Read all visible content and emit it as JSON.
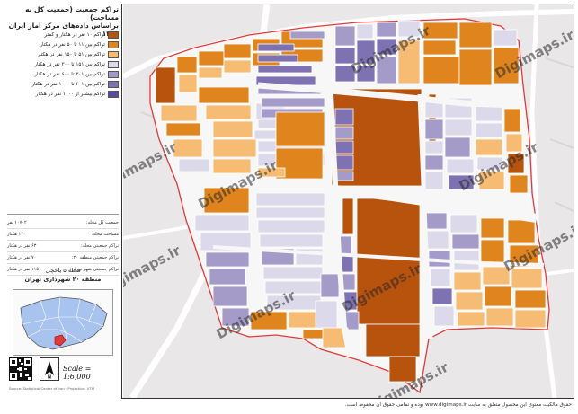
{
  "title": "تراکم جمعیت (جمعیت کل به مساحت)",
  "subtitle": "براساس داده‌های مرکز آمار ایران ۱۳۹۵",
  "legend": [
    {
      "label": "تراکم ۱۰ نفر در هکتار و کمتر",
      "color": "#b8530e"
    },
    {
      "label": "تراکم بین ۱۱ تا ۵۰ نفر در هکتار",
      "color": "#e0851d"
    },
    {
      "label": "تراکم بین ۵۱ تا ۱۵۰ نفر در هکتار",
      "color": "#f6bc73"
    },
    {
      "label": "تراکم بین ۱۵۱ تا ۳۰۰ نفر در هکتار",
      "color": "#dcdaea"
    },
    {
      "label": "تراکم بین ۳۰۱ تا ۶۰۰ نفر در هکتار",
      "color": "#a49bc9"
    },
    {
      "label": "تراکم بین ۶۰۱ تا ۱۰۰۰ نفر در هکتار",
      "color": "#7e72b2"
    },
    {
      "label": "تراکم بیشتر از ۱۰۰۰ نفر در هکتار",
      "color": "#5a4aa0"
    }
  ],
  "stats": [
    {
      "label": "جمعیت کل محله:",
      "value": "۱۰۷۰۲ نفر"
    },
    {
      "label": "مساحت محله:",
      "value": "۱۷۰ هکتار"
    },
    {
      "label": "تراکم جمعیتی محله:",
      "value": "۶۳ نفر در هکتار"
    },
    {
      "label": "تراکم جمعیتی منطقه ۲۰:",
      "value": "۷۰ نفر در هکتار"
    },
    {
      "label": "تراکم جمعیتی شهر تهران:",
      "value": "۱۱۵ نفر در هکتار"
    }
  ],
  "district": {
    "neighborhood": "محله ۵ یاخچی",
    "zone": "منطقه ۲۰ شهرداری تهران"
  },
  "scale": "Scale = 1:6,000",
  "north": "N",
  "credit": "Source: Statistical Center of Iran · Projection: UTM",
  "watermark": "Digimaps.ir",
  "footer": "حقوق مالکیت معنوی این محصول متعلق به سایت www.digimaps.ir بوده و تمامی حقوق آن محفوظ است.",
  "colors": {
    "c1": "#b8530e",
    "c2": "#e0851d",
    "c3": "#f6bc73",
    "c4": "#dcdaea",
    "c5": "#a49bc9",
    "c6": "#7e72b2",
    "c7": "#5a4aa0",
    "road": "#f7f7f7",
    "background": "#eceaea",
    "boundary": "#e23a3a"
  }
}
